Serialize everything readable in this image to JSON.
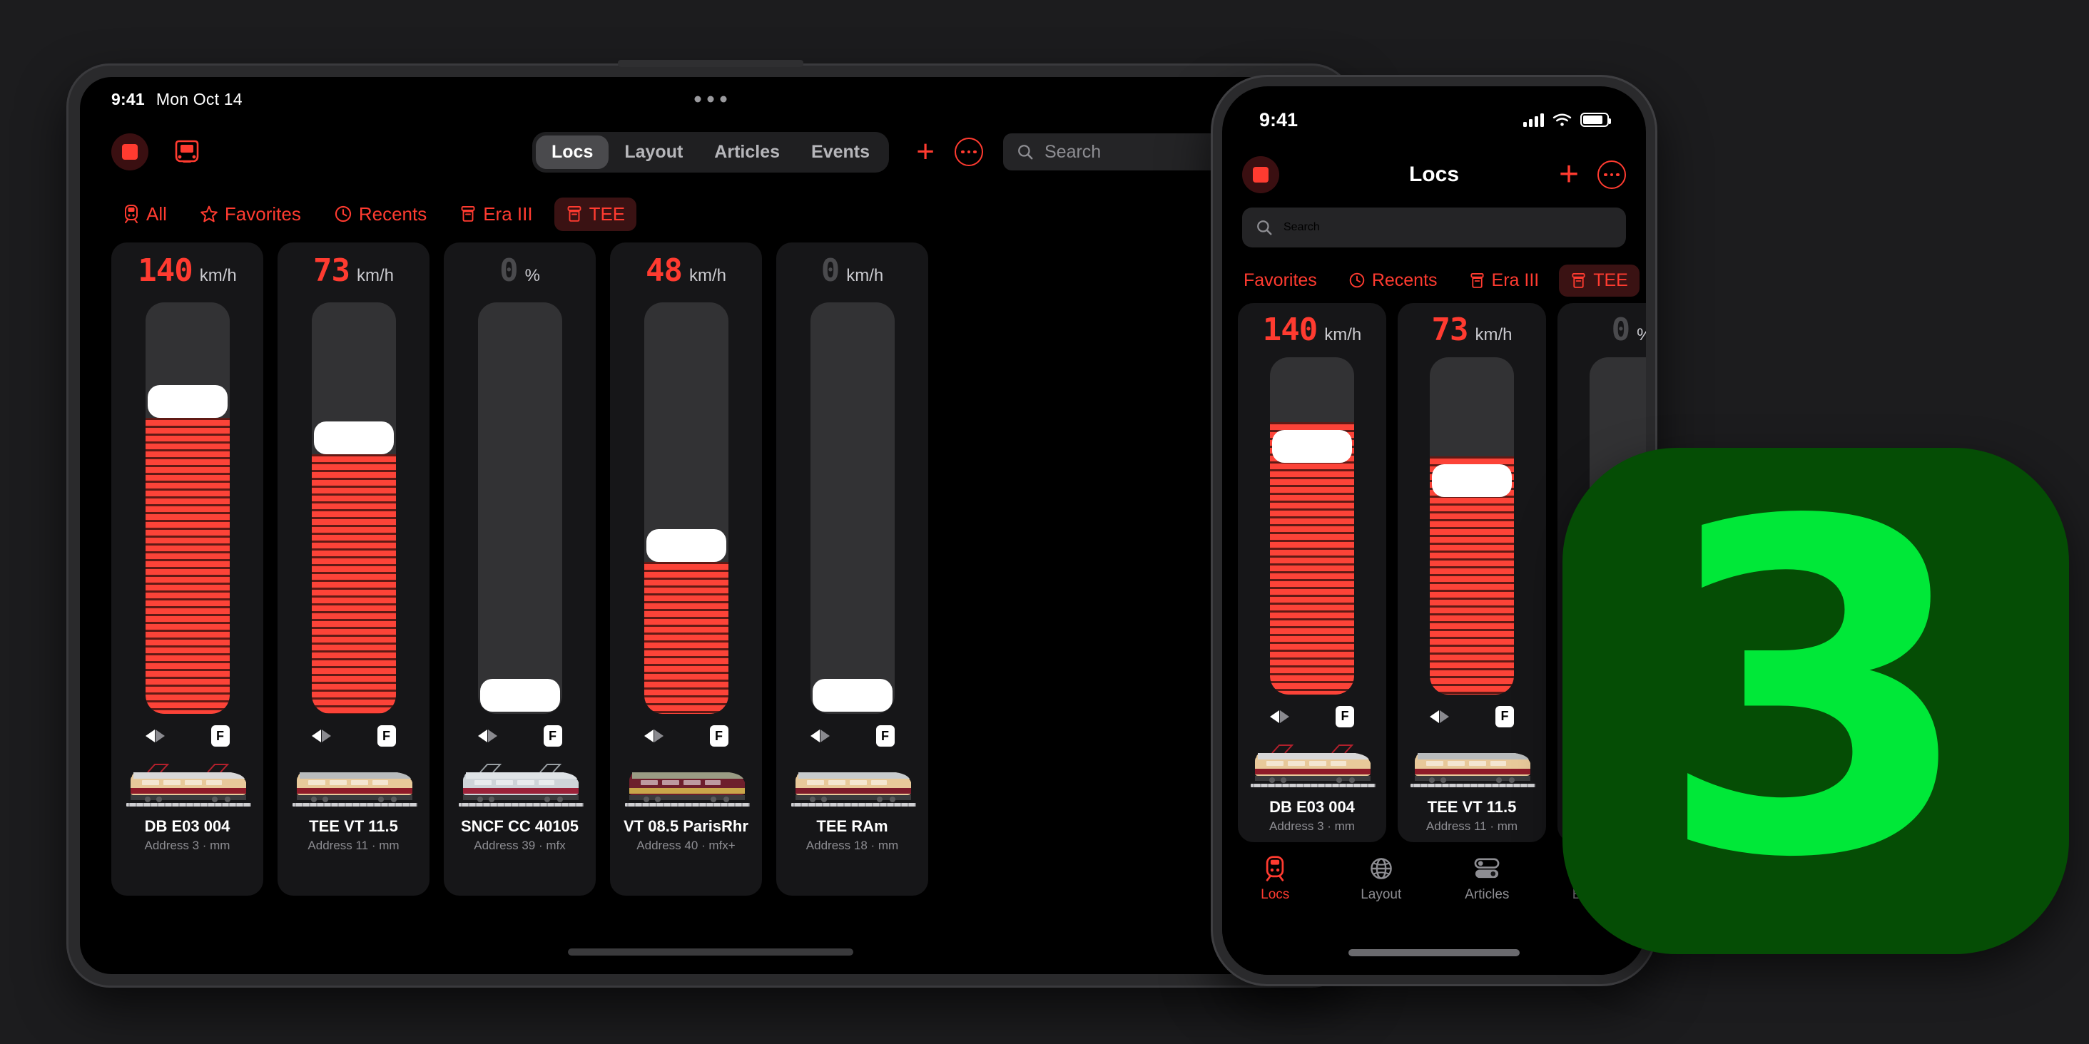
{
  "ipad": {
    "status": {
      "time": "9:41",
      "date": "Mon Oct 14",
      "multitask_handle": "multitask-dots"
    },
    "nav": {
      "stop_button": "stop-button",
      "train_button": "train-icon",
      "tabs": [
        {
          "label": "Locs",
          "active": true
        },
        {
          "label": "Layout",
          "active": false
        },
        {
          "label": "Articles",
          "active": false
        },
        {
          "label": "Events",
          "active": false
        }
      ],
      "add_label": "+",
      "more_label": "more-options",
      "search_placeholder": "Search",
      "search_value": ""
    },
    "filters": [
      {
        "label": "All",
        "icon": "train-icon",
        "selected": false
      },
      {
        "label": "Favorites",
        "icon": "star-icon",
        "selected": false
      },
      {
        "label": "Recents",
        "icon": "clock-icon",
        "selected": false
      },
      {
        "label": "Era III",
        "icon": "archive-icon",
        "selected": false
      },
      {
        "label": "TEE",
        "icon": "archive-icon",
        "selected": true
      }
    ],
    "edit_fab": "compose-icon",
    "home_indicator": "home-indicator"
  },
  "locos": [
    {
      "speed": "140",
      "unit": "km/h",
      "active": true,
      "percent": 72,
      "name": "DB E03 004",
      "address": "Address 3 · mm",
      "direction": "reverse",
      "func": "F",
      "livery": "cream-red-electric"
    },
    {
      "speed": "73",
      "unit": "km/h",
      "active": true,
      "percent": 63,
      "name": "TEE VT 11.5",
      "address": "Address 11 · mm",
      "direction": "reverse",
      "func": "F",
      "livery": "red-cream-railcar"
    },
    {
      "speed": "0",
      "unit": "%",
      "active": false,
      "percent": 0,
      "name": "SNCF CC 40105",
      "address": "Address 39 · mfx",
      "direction": "reverse",
      "func": "F",
      "livery": "silver-red-electric"
    },
    {
      "speed": "48",
      "unit": "km/h",
      "active": true,
      "percent": 37,
      "name": "VT 08.5 ParisRhr",
      "address": "Address 40 · mfx+",
      "direction": "reverse",
      "func": "F",
      "livery": "maroon-railcar"
    },
    {
      "speed": "0",
      "unit": "km/h",
      "active": false,
      "percent": 0,
      "name": "TEE RAm",
      "address": "Address 18 · mm",
      "direction": "reverse",
      "func": "F",
      "livery": "cream-maroon-railcar"
    }
  ],
  "iphone": {
    "status": {
      "time": "9:41",
      "cellular": "signal-icon",
      "wifi": "wifi-icon",
      "battery": "battery-icon"
    },
    "nav": {
      "title": "Locs",
      "stop_button": "stop-button",
      "add_label": "+",
      "more_label": "more-options"
    },
    "search_placeholder": "Search",
    "filters": [
      {
        "label": "Favorites",
        "icon": "star-icon",
        "selected": false
      },
      {
        "label": "Recents",
        "icon": "clock-icon",
        "selected": false
      },
      {
        "label": "Era III",
        "icon": "archive-icon",
        "selected": false
      },
      {
        "label": "TEE",
        "icon": "archive-icon",
        "selected": true
      }
    ],
    "tabbar": [
      {
        "label": "Locs",
        "icon": "train-icon",
        "active": true
      },
      {
        "label": "Layout",
        "icon": "globe-icon",
        "active": false
      },
      {
        "label": "Articles",
        "icon": "sliders-icon",
        "active": false
      },
      {
        "label": "Events",
        "icon": "calendar-icon",
        "active": false
      }
    ],
    "home_indicator": "home-indicator"
  },
  "app_icon": {
    "glyph": "3",
    "background": "#054d05",
    "foreground": "#00e838"
  },
  "colors": {
    "accent_red": "#ff3b30",
    "throttle_red": "#fc4338",
    "card_bg": "#161618",
    "screen_bg": "#000000",
    "page_bg": "#1c1c1e",
    "selected_chip_bg": "#3a1213"
  }
}
